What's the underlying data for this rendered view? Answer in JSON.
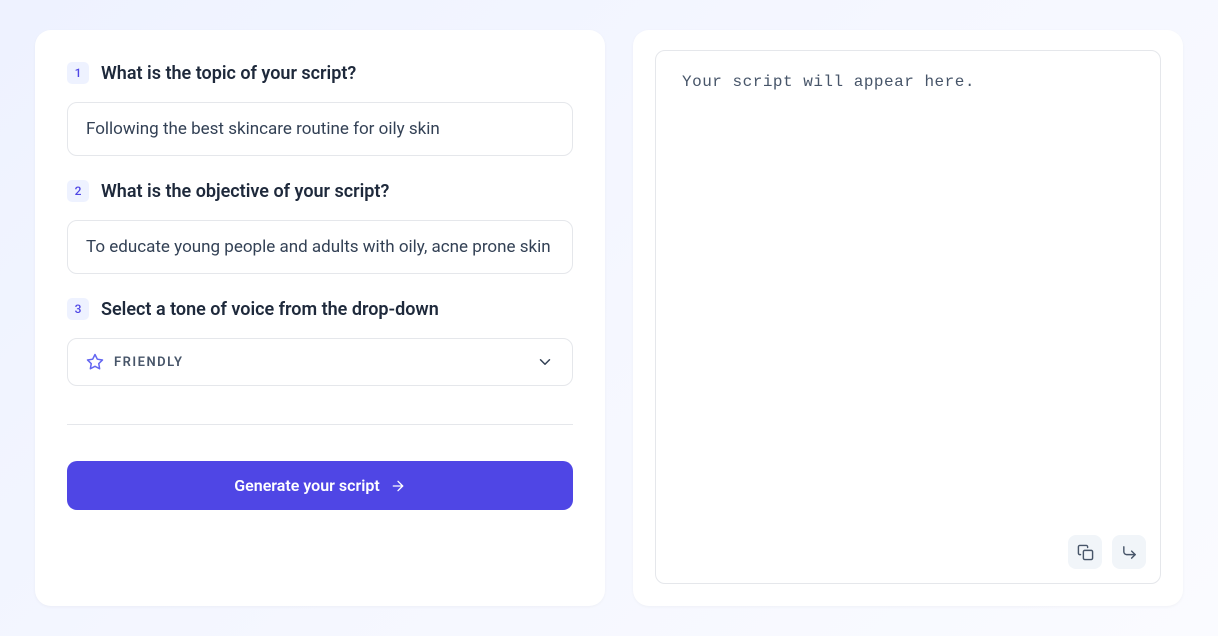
{
  "form": {
    "step1": {
      "number": "1",
      "label": "What is the topic of your script?",
      "value": "Following the best skincare routine for oily skin"
    },
    "step2": {
      "number": "2",
      "label": "What is the objective of your script?",
      "value": "To educate young people and adults with oily, acne prone skin"
    },
    "step3": {
      "number": "3",
      "label": "Select a tone of voice from the drop-down",
      "selected": "FRIENDLY"
    },
    "submit_label": "Generate your script"
  },
  "output": {
    "placeholder": "Your script will appear here."
  }
}
